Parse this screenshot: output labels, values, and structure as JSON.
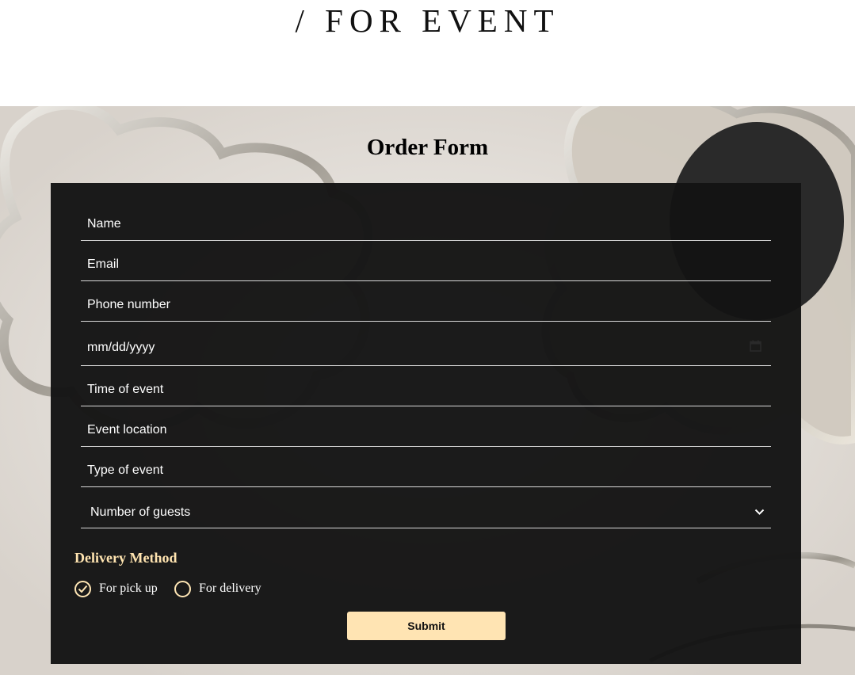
{
  "header": {
    "title": "/ FOR EVENT"
  },
  "form": {
    "title": "Order Form",
    "fields": {
      "name": {
        "placeholder": "Name"
      },
      "email": {
        "placeholder": "Email"
      },
      "phone": {
        "placeholder": "Phone number"
      },
      "date": {
        "placeholder": "mm/dd/yyyy"
      },
      "time": {
        "placeholder": "Time of event"
      },
      "location": {
        "placeholder": "Event location"
      },
      "type": {
        "placeholder": "Type of event"
      },
      "guests": {
        "selected": "Number of guests"
      }
    },
    "delivery": {
      "title": "Delivery Method",
      "options": [
        {
          "label": "For pick up",
          "checked": true
        },
        {
          "label": "For delivery",
          "checked": false
        }
      ]
    },
    "submit_label": "Submit"
  },
  "colors": {
    "card": "#141414",
    "accent": "#ffe4b3",
    "text": "#ffffff"
  }
}
